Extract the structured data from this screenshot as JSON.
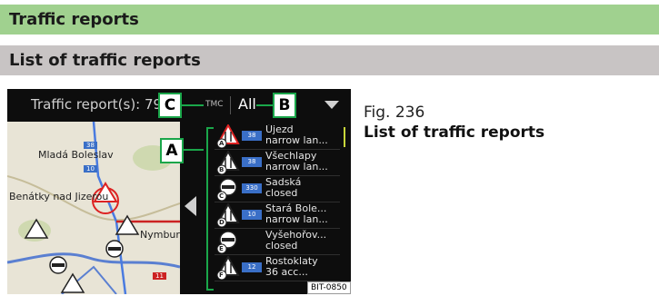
{
  "headings": {
    "section": "Traffic reports",
    "subsection": "List of traffic reports"
  },
  "topbar": {
    "count": "Traffic report(s): 79",
    "tmc": "TMC",
    "filter": "All"
  },
  "callouts": {
    "a": "A",
    "b": "B",
    "c": "C"
  },
  "map": {
    "labels": [
      "Mladá Boleslav",
      "Benátky nad Jizerou",
      "Nymburk"
    ],
    "road_numbers": [
      "38",
      "10",
      "11"
    ],
    "markers": [
      "A",
      "B",
      "C",
      "D",
      "E",
      "F"
    ]
  },
  "list": [
    {
      "marker": "A",
      "icon": "roadworks-icon",
      "road": "38",
      "line1": "Újezd",
      "line2": "narrow lan...",
      "warning_red": true
    },
    {
      "marker": "B",
      "icon": "narrow-road-icon",
      "road": "38",
      "line1": "Všechlapy",
      "line2": "narrow lan...",
      "warning_red": false
    },
    {
      "marker": "C",
      "icon": "road-closed-icon",
      "road": "330",
      "line1": "Sadská",
      "line2": "closed",
      "warning_red": false
    },
    {
      "marker": "D",
      "icon": "narrow-road-icon",
      "road": "10",
      "line1": "Stará Bole...",
      "line2": "narrow lan...",
      "warning_red": false
    },
    {
      "marker": "E",
      "icon": "road-closed-icon",
      "road": "",
      "line1": "Vyšehořov...",
      "line2": "closed",
      "warning_red": false
    },
    {
      "marker": "F",
      "icon": "accident-icon",
      "road": "12",
      "line1": "Rostoklaty",
      "line2": "36 acc...",
      "warning_red": false
    }
  ],
  "image_code": "BIT-0850",
  "caption": {
    "number": "Fig. 236",
    "title": "List of traffic reports"
  },
  "colors": {
    "heading1": "#a0d18f",
    "heading2": "#c8c4c4",
    "callout_green": "#1aa64a",
    "badge_blue": "#3a6fc7"
  }
}
